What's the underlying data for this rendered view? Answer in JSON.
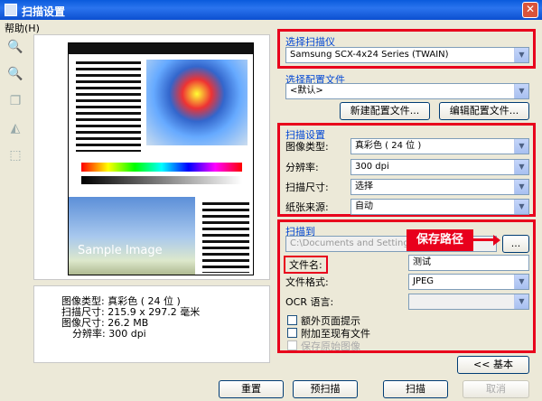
{
  "window": {
    "title": "扫描设置",
    "close": "✕"
  },
  "menu": {
    "help": "帮助(H)"
  },
  "tools": [
    "zoom-in-icon",
    "zoom-out-icon",
    "copy-icon",
    "flip-icon",
    "crop-icon"
  ],
  "preview": {
    "sample_text": "Sample Image"
  },
  "info": {
    "rows": [
      {
        "label": "图像类型:",
        "value": "真彩色 ( 24 位 )"
      },
      {
        "label": "扫描尺寸:",
        "value": "215.9 x 297.2 毫米"
      },
      {
        "label": "图像尺寸:",
        "value": "26.2 MB"
      },
      {
        "label": "分辨率:",
        "value": "300 dpi"
      }
    ]
  },
  "scanner": {
    "title": "选择扫描仪",
    "value": "Samsung SCX-4x24 Series (TWAIN)"
  },
  "profile": {
    "title": "选择配置文件",
    "value": "<默认>",
    "new_button": "新建配置文件...",
    "edit_button": "编辑配置文件..."
  },
  "settings": {
    "title": "扫描设置",
    "image_type_label": "图像类型:",
    "image_type": "真彩色 ( 24 位 )",
    "resolution_label": "分辨率:",
    "resolution": "300 dpi",
    "scan_size_label": "扫描尺寸:",
    "scan_size": "选择",
    "paper_source_label": "纸张来源:",
    "paper_source": "自动"
  },
  "scan_to": {
    "title": "扫描到",
    "path": "C:\\Documents and Settings\\",
    "browse": "...",
    "callout": "保存路径",
    "filename_label": "文件名:",
    "filename": "测试",
    "format_label": "文件格式:",
    "format": "JPEG",
    "ocr_label": "OCR 语言:",
    "ocr": "",
    "opt_extra_prompt": "额外页面提示",
    "opt_append": "附加至现有文件",
    "opt_keep_original": "保存原始图像"
  },
  "buttons": {
    "basic": "<< 基本",
    "reset": "重置",
    "prescan": "预扫描",
    "scan": "扫描",
    "cancel": "取消"
  },
  "colors": {
    "highlight": "#e8001c",
    "group_title": "#0046d5",
    "titlebar": "#0a5bdc"
  }
}
